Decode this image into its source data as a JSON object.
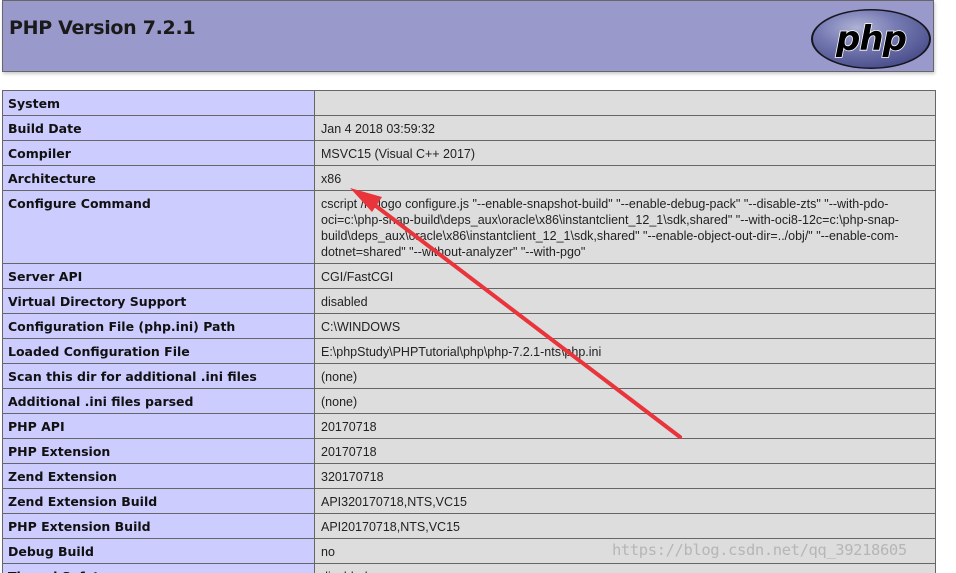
{
  "header": {
    "title": "PHP Version 7.2.1",
    "logo_text": "php"
  },
  "rows": [
    {
      "label": "System",
      "value": ""
    },
    {
      "label": "Build Date",
      "value": "Jan 4 2018 03:59:32"
    },
    {
      "label": "Compiler",
      "value": "MSVC15 (Visual C++ 2017)"
    },
    {
      "label": "Architecture",
      "value": "x86"
    },
    {
      "label": "Configure Command",
      "value": "cscript /nologo configure.js \"--enable-snapshot-build\" \"--enable-debug-pack\" \"--disable-zts\" \"--with-pdo-oci=c:\\php-snap-build\\deps_aux\\oracle\\x86\\instantclient_12_1\\sdk,shared\" \"--with-oci8-12c=c:\\php-snap-build\\deps_aux\\oracle\\x86\\instantclient_12_1\\sdk,shared\" \"--enable-object-out-dir=../obj/\" \"--enable-com-dotnet=shared\" \"--without-analyzer\" \"--with-pgo\""
    },
    {
      "label": "Server API",
      "value": "CGI/FastCGI"
    },
    {
      "label": "Virtual Directory Support",
      "value": "disabled"
    },
    {
      "label": "Configuration File (php.ini) Path",
      "value": "C:\\WINDOWS"
    },
    {
      "label": "Loaded Configuration File",
      "value": "E:\\phpStudy\\PHPTutorial\\php\\php-7.2.1-nts\\php.ini"
    },
    {
      "label": "Scan this dir for additional .ini files",
      "value": "(none)"
    },
    {
      "label": "Additional .ini files parsed",
      "value": "(none)"
    },
    {
      "label": "PHP API",
      "value": "20170718"
    },
    {
      "label": "PHP Extension",
      "value": "20170718"
    },
    {
      "label": "Zend Extension",
      "value": "320170718"
    },
    {
      "label": "Zend Extension Build",
      "value": "API320170718,NTS,VC15"
    },
    {
      "label": "PHP Extension Build",
      "value": "API20170718,NTS,VC15"
    },
    {
      "label": "Debug Build",
      "value": "no"
    },
    {
      "label": "Thread Safety",
      "value": "disabled"
    }
  ],
  "watermark": "https://blog.csdn.net/qq_39218605",
  "colors": {
    "header_bg": "#9999cc",
    "label_bg": "#ccccff",
    "value_bg": "#dddddd",
    "arrow": "#e8343a"
  }
}
